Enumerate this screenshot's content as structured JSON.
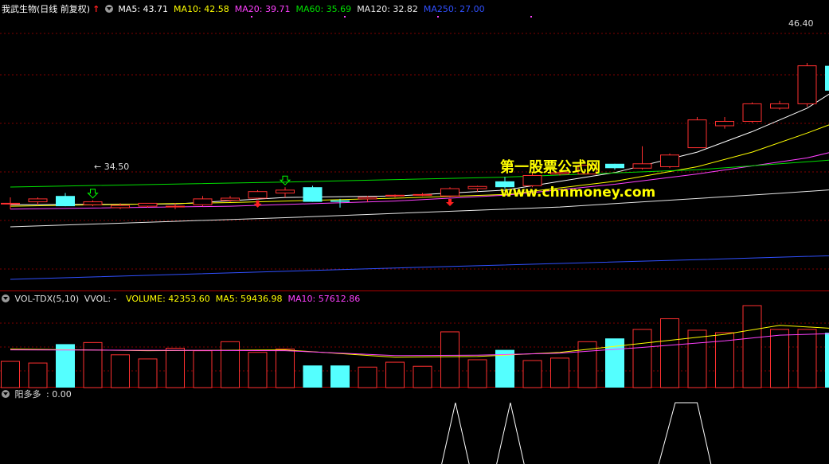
{
  "chart_data": [
    {
      "type": "candlestick",
      "panel": "main",
      "title": "我武生物(日线 前复权)",
      "up_arrow": "↑",
      "indicators": [
        {
          "label": "MA5",
          "value": "43.71",
          "color": "#ffffff"
        },
        {
          "label": "MA10",
          "value": "42.58",
          "color": "#ffff00"
        },
        {
          "label": "MA20",
          "value": "39.71",
          "color": "#ff40ff"
        },
        {
          "label": "MA60",
          "value": "35.69",
          "color": "#00e000"
        },
        {
          "label": "MA120",
          "value": "32.82",
          "color": "#e8e8e8"
        },
        {
          "label": "MA250",
          "value": "27.00",
          "color": "#3050ff"
        }
      ],
      "ylim": [
        29.0,
        47.5
      ],
      "annotations": {
        "high_label": "46.40",
        "low_label": "34.50",
        "low_prefix": "←"
      },
      "candles": [
        {
          "o": 34.8,
          "h": 35.2,
          "l": 34.4,
          "c": 34.8
        },
        {
          "o": 34.9,
          "h": 35.2,
          "l": 34.7,
          "c": 35.1
        },
        {
          "o": 35.3,
          "h": 35.5,
          "l": 34.6,
          "c": 34.6
        },
        {
          "o": 34.7,
          "h": 35.0,
          "l": 34.6,
          "c": 34.9
        },
        {
          "o": 34.5,
          "h": 34.8,
          "l": 34.4,
          "c": 34.65
        },
        {
          "o": 34.6,
          "h": 34.8,
          "l": 34.5,
          "c": 34.8
        },
        {
          "o": 34.6,
          "h": 34.8,
          "l": 34.4,
          "c": 34.6
        },
        {
          "o": 34.7,
          "h": 35.3,
          "l": 34.6,
          "c": 35.1
        },
        {
          "o": 35.0,
          "h": 35.3,
          "l": 34.9,
          "c": 35.15
        },
        {
          "o": 35.15,
          "h": 35.7,
          "l": 35.1,
          "c": 35.6
        },
        {
          "o": 35.5,
          "h": 35.9,
          "l": 35.2,
          "c": 35.7
        },
        {
          "o": 35.9,
          "h": 36.0,
          "l": 34.9,
          "c": 34.9
        },
        {
          "o": 35.0,
          "h": 35.1,
          "l": 34.5,
          "c": 34.9
        },
        {
          "o": 35.1,
          "h": 35.3,
          "l": 34.9,
          "c": 35.2
        },
        {
          "o": 35.3,
          "h": 35.4,
          "l": 35.2,
          "c": 35.35
        },
        {
          "o": 35.35,
          "h": 35.5,
          "l": 35.3,
          "c": 35.4
        },
        {
          "o": 35.3,
          "h": 35.9,
          "l": 35.2,
          "c": 35.8
        },
        {
          "o": 35.8,
          "h": 36.0,
          "l": 35.6,
          "c": 35.95
        },
        {
          "o": 36.3,
          "h": 36.6,
          "l": 35.8,
          "c": 35.9
        },
        {
          "o": 36.0,
          "h": 36.9,
          "l": 35.9,
          "c": 36.7
        },
        {
          "o": 36.8,
          "h": 37.1,
          "l": 36.7,
          "c": 36.9
        },
        {
          "o": 36.8,
          "h": 37.4,
          "l": 36.8,
          "c": 37.4
        },
        {
          "o": 37.5,
          "h": 37.5,
          "l": 37.1,
          "c": 37.2
        },
        {
          "o": 37.2,
          "h": 38.7,
          "l": 37.1,
          "c": 37.5
        },
        {
          "o": 37.3,
          "h": 38.2,
          "l": 37.2,
          "c": 38.1
        },
        {
          "o": 38.6,
          "h": 40.7,
          "l": 38.6,
          "c": 40.5
        },
        {
          "o": 40.1,
          "h": 40.7,
          "l": 39.9,
          "c": 40.4
        },
        {
          "o": 40.4,
          "h": 41.7,
          "l": 40.3,
          "c": 41.6
        },
        {
          "o": 41.3,
          "h": 41.8,
          "l": 41.2,
          "c": 41.6
        },
        {
          "o": 41.6,
          "h": 44.4,
          "l": 41.4,
          "c": 44.2
        },
        {
          "o": 44.2,
          "h": 46.4,
          "l": 42.5,
          "c": 42.5
        },
        {
          "o": 43.6,
          "h": 43.7,
          "l": 42.5,
          "c": 42.6
        },
        {
          "o": 42.8,
          "h": 44.4,
          "l": 42.6,
          "c": 43.9
        },
        {
          "o": 43.1,
          "h": 46.2,
          "l": 43.1,
          "c": 45.4
        }
      ],
      "ma": {
        "MA5": [
          [
            0,
            34.7
          ],
          [
            6,
            34.75
          ],
          [
            10,
            35.2
          ],
          [
            14,
            35.3
          ],
          [
            18,
            35.7
          ],
          [
            22,
            36.9
          ],
          [
            25,
            38.3
          ],
          [
            27,
            39.7
          ],
          [
            29,
            41.3
          ],
          [
            30,
            42.5
          ],
          [
            32,
            43.2
          ],
          [
            33,
            43.71
          ]
        ],
        "MA10": [
          [
            0,
            34.6
          ],
          [
            8,
            34.85
          ],
          [
            14,
            35.15
          ],
          [
            18,
            35.4
          ],
          [
            22,
            36.3
          ],
          [
            25,
            37.3
          ],
          [
            27,
            38.3
          ],
          [
            29,
            39.6
          ],
          [
            31,
            41.0
          ],
          [
            33,
            42.58
          ]
        ],
        "MA20": [
          [
            0,
            34.4
          ],
          [
            8,
            34.6
          ],
          [
            14,
            34.95
          ],
          [
            18,
            35.35
          ],
          [
            22,
            36.1
          ],
          [
            25,
            36.8
          ],
          [
            29,
            37.9
          ],
          [
            31,
            38.8
          ],
          [
            33,
            39.71
          ]
        ],
        "MA60": [
          [
            0,
            32.6
          ],
          [
            10,
            33.0
          ],
          [
            18,
            33.4
          ],
          [
            25,
            34.0
          ],
          [
            30,
            34.8
          ],
          [
            33,
            35.69
          ]
        ],
        "MA120": [
          [
            0,
            30.0
          ],
          [
            10,
            30.6
          ],
          [
            20,
            31.3
          ],
          [
            28,
            32.2
          ],
          [
            33,
            32.82
          ]
        ],
        "MA250": [
          [
            0,
            24.2
          ],
          [
            15,
            25.5
          ],
          [
            25,
            26.3
          ],
          [
            33,
            27.0
          ]
        ]
      },
      "signals": {
        "buy_idx": [
          3,
          10
        ],
        "sell_idx": [
          9,
          16
        ]
      }
    },
    {
      "type": "bar",
      "panel": "volume",
      "title": "VOL-TDX(5,10)",
      "extra": "VVOL: -",
      "indicators": [
        {
          "label": "VOLUME",
          "value": "42353.60",
          "color": "#ffff00"
        },
        {
          "label": "MA5",
          "value": "59436.98",
          "color": "#ffff00"
        },
        {
          "label": "MA10",
          "value": "57612.86",
          "color": "#ff40ff"
        }
      ],
      "ylim": [
        0,
        100000
      ],
      "values": [
        32000,
        30000,
        53000,
        55000,
        40000,
        35000,
        48000,
        45000,
        56000,
        43000,
        47000,
        27000,
        27000,
        25000,
        31000,
        26000,
        68000,
        34000,
        46000,
        33000,
        36000,
        56000,
        60000,
        71000,
        84000,
        70000,
        67000,
        100000,
        71000,
        71000,
        67000,
        65000,
        64000,
        42353.6
      ],
      "ma5": [
        [
          0,
          47000
        ],
        [
          5,
          45000
        ],
        [
          10,
          46000
        ],
        [
          14,
          37000
        ],
        [
          17,
          38000
        ],
        [
          20,
          43000
        ],
        [
          23,
          54000
        ],
        [
          26,
          65000
        ],
        [
          28,
          76000
        ],
        [
          30,
          72000
        ],
        [
          33,
          66000
        ]
      ],
      "ma10": [
        [
          0,
          46000
        ],
        [
          5,
          45500
        ],
        [
          10,
          45000
        ],
        [
          14,
          39000
        ],
        [
          17,
          39500
        ],
        [
          20,
          42000
        ],
        [
          23,
          49000
        ],
        [
          26,
          57000
        ],
        [
          28,
          64000
        ],
        [
          30,
          66000
        ],
        [
          33,
          64500
        ]
      ]
    },
    {
      "type": "line",
      "panel": "indicator",
      "title": "阳多多",
      "value": ": 0.00",
      "ylim": [
        0,
        1
      ],
      "series": [
        [
          [
            15.7,
            0
          ],
          [
            16.2,
            1
          ],
          [
            16.7,
            0
          ]
        ],
        [
          [
            17.7,
            0
          ],
          [
            18.2,
            1
          ],
          [
            18.7,
            0
          ]
        ],
        [
          [
            23.6,
            0
          ],
          [
            24.2,
            1
          ],
          [
            25.0,
            1
          ],
          [
            25.5,
            0
          ]
        ]
      ]
    }
  ],
  "watermark": {
    "line1": "第一股票公式网",
    "line2": "www.chnmoney.com"
  },
  "colors": {
    "up": "#ff3030",
    "down": "#54ffff",
    "grid": "#800000",
    "border": "#aa0000",
    "title": "#ffffff",
    "watermark": "#ffff00"
  }
}
